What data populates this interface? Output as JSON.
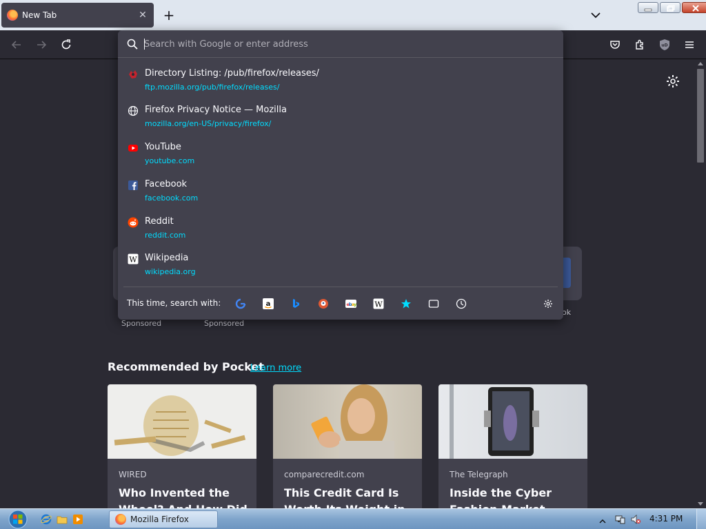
{
  "window": {
    "tab_title": "New Tab"
  },
  "urlbar": {
    "placeholder": "Search with Google or enter address",
    "value": ""
  },
  "results": [
    {
      "title": "Directory Listing: /pub/firefox/releases/",
      "url": "ftp.mozilla.org/pub/firefox/releases/",
      "icon": "mozilla-ftp-icon"
    },
    {
      "title": "Firefox Privacy Notice — Mozilla",
      "url": "mozilla.org/en-US/privacy/firefox/",
      "icon": "globe-icon"
    },
    {
      "title": "YouTube",
      "url": "youtube.com",
      "icon": "youtube-icon"
    },
    {
      "title": "Facebook",
      "url": "facebook.com",
      "icon": "facebook-icon"
    },
    {
      "title": "Reddit",
      "url": "reddit.com",
      "icon": "reddit-icon"
    },
    {
      "title": "Wikipedia",
      "url": "wikipedia.org",
      "icon": "wikipedia-icon"
    }
  ],
  "oneoff": {
    "label": "This time, search with:",
    "engines": [
      "google-icon",
      "amazon-icon",
      "bing-icon",
      "duckduckgo-icon",
      "ebay-icon",
      "wikipedia-icon",
      "bookmarks-icon",
      "tabs-icon",
      "history-icon"
    ]
  },
  "topsites": {
    "sponsored_label_1": "Sponsored",
    "sponsored_label_2": "Sponsored",
    "partial_label": "ok"
  },
  "pocket": {
    "heading": "Recommended by Pocket",
    "learn_more": "Learn more",
    "cards": [
      {
        "source": "WIRED",
        "headline": "Who Invented the Wheel? And How Did"
      },
      {
        "source": "comparecredit.com",
        "headline": "This Credit Card Is Worth Its Weight in"
      },
      {
        "source": "The Telegraph",
        "headline": "Inside the Cyber Fashion Market Where"
      }
    ]
  },
  "taskbar": {
    "active_task": "Mozilla Firefox",
    "clock": "4:31 PM"
  },
  "colors": {
    "accent_link": "#00ddff",
    "panel": "#42414d",
    "background": "#2b2a33"
  }
}
